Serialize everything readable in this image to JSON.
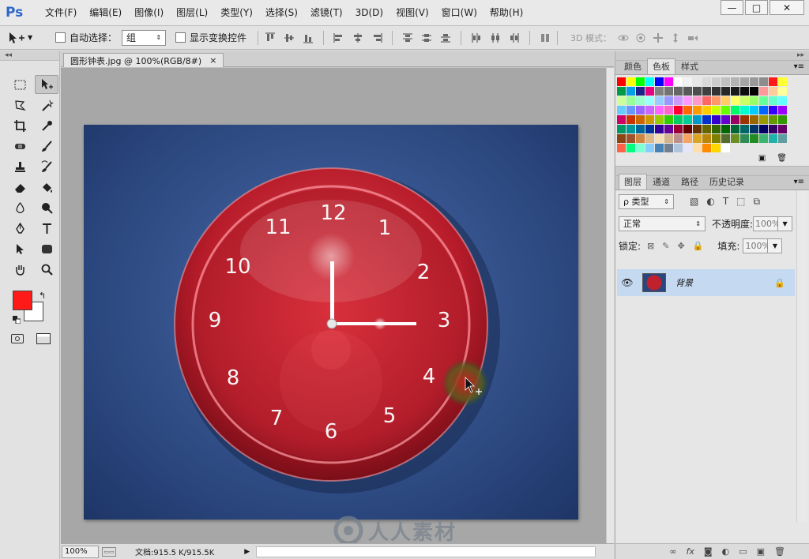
{
  "app": {
    "logo": "Ps"
  },
  "menu": [
    "文件(F)",
    "编辑(E)",
    "图像(I)",
    "图层(L)",
    "类型(Y)",
    "选择(S)",
    "滤镜(T)",
    "3D(D)",
    "视图(V)",
    "窗口(W)",
    "帮助(H)"
  ],
  "window": {
    "minimize": "—",
    "maximize": "□",
    "close": "✕"
  },
  "options": {
    "auto_select_label": "自动选择：",
    "auto_select_value": "组",
    "show_transform_label": "显示变换控件",
    "mode_3d_label": "3D 模式："
  },
  "document": {
    "tab_title": "圆形钟表.jpg @ 100%(RGB/8#)",
    "tab_close": "×",
    "zoom": "100%",
    "doc_size": "文档:915.5 K/915.5K",
    "clock_numbers": [
      "12",
      "1",
      "2",
      "3",
      "4",
      "5",
      "6",
      "7",
      "8",
      "9",
      "10",
      "11"
    ]
  },
  "watermark": "人人素材",
  "swatches_panel": {
    "tabs": [
      "颜色",
      "色板",
      "样式"
    ],
    "active_tab": "色板",
    "colors": [
      "#ff0000",
      "#ffff00",
      "#00ff00",
      "#00ffff",
      "#0000ff",
      "#ff00ff",
      "#ffffff",
      "#f2f2f2",
      "#e6e6e6",
      "#d9d9d9",
      "#cccccc",
      "#bfbfbf",
      "#b3b3b3",
      "#a6a6a6",
      "#999999",
      "#8c8c8c",
      "#ff1a1a",
      "#ffff33",
      "#009944",
      "#00a0e9",
      "#1d2088",
      "#e4007f",
      "#808080",
      "#737373",
      "#666666",
      "#595959",
      "#4d4d4d",
      "#404040",
      "#333333",
      "#262626",
      "#1a1a1a",
      "#0d0d0d",
      "#000000",
      "#ff9999",
      "#ffcc99",
      "#ffff99",
      "#ccff99",
      "#99ff99",
      "#99ffcc",
      "#99ffff",
      "#99ccff",
      "#9999ff",
      "#cc99ff",
      "#ff99ff",
      "#ff99cc",
      "#ff6666",
      "#ff9966",
      "#ffcc66",
      "#ffff66",
      "#ccff66",
      "#99ff66",
      "#66ff99",
      "#66ffcc",
      "#66ffff",
      "#66ccff",
      "#6699ff",
      "#9966ff",
      "#cc66ff",
      "#ff66ff",
      "#ff66cc",
      "#ff0033",
      "#ff6600",
      "#ff9900",
      "#ffcc00",
      "#ccff00",
      "#66ff00",
      "#00ff66",
      "#00ffcc",
      "#00ccff",
      "#0066ff",
      "#3300ff",
      "#9900ff",
      "#cc0066",
      "#cc3300",
      "#cc6600",
      "#cc9900",
      "#99cc00",
      "#33cc00",
      "#00cc66",
      "#00cc99",
      "#0099cc",
      "#0033cc",
      "#3300cc",
      "#6600cc",
      "#990066",
      "#993300",
      "#996600",
      "#999900",
      "#669900",
      "#339900",
      "#009966",
      "#009999",
      "#006699",
      "#003399",
      "#330099",
      "#660099",
      "#990033",
      "#660000",
      "#663300",
      "#666600",
      "#336600",
      "#006600",
      "#006633",
      "#006666",
      "#003366",
      "#000066",
      "#330066",
      "#660066",
      "#8b4513",
      "#a0522d",
      "#cd853f",
      "#deb887",
      "#f5deb3",
      "#d2b48c",
      "#bc8f8f",
      "#f4a460",
      "#daa520",
      "#b8860b",
      "#808000",
      "#556b2f",
      "#6b8e23",
      "#2e8b57",
      "#228b22",
      "#3cb371",
      "#20b2aa",
      "#5f9ea0",
      "#ff6347",
      "#00ff7f",
      "#7fffd4",
      "#87cefa",
      "#4682b4",
      "#708090",
      "#b0c4de",
      "#e6e6fa",
      "#ffdead",
      "#ff8c00",
      "#ffd700",
      "#ffffff"
    ]
  },
  "layers_panel": {
    "tabs": [
      "图层",
      "通道",
      "路径",
      "历史记录"
    ],
    "active_tab": "图层",
    "filter_label": "ρ 类型",
    "blend_mode": "正常",
    "opacity_label": "不透明度:",
    "opacity_value": "100%",
    "lock_label": "锁定:",
    "fill_label": "填充:",
    "fill_value": "100%",
    "layer_name": "背景",
    "footer_icons": [
      "link-icon",
      "fx-icon",
      "mask-icon",
      "adjustment-icon",
      "folder-icon",
      "new-layer-icon",
      "trash-icon"
    ]
  }
}
